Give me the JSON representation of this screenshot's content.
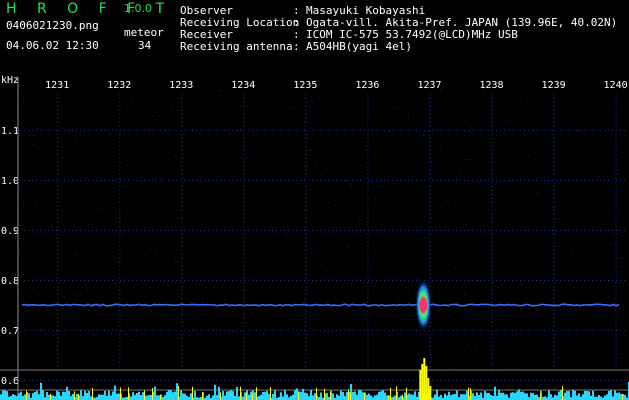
{
  "app": {
    "name": "H R O F F T",
    "version": "1.0.0"
  },
  "file": {
    "name": "0406021230.png",
    "datetime": "04.06.02 12:30",
    "meteor_label": "meteor",
    "meteor_count": "34"
  },
  "info": [
    {
      "label": "Observer",
      "sep": ":",
      "value": "Masayuki Kobayashi"
    },
    {
      "label": "Receiving Location",
      "sep": ":",
      "value": "Ogata-vill. Akita-Pref. JAPAN (139.96E, 40.02N)"
    },
    {
      "label": "Receiver",
      "sep": ":",
      "value": "ICOM IC-575 53.7492(@LCD)MHz USB"
    },
    {
      "label": "Receiving antenna",
      "sep": ":",
      "value": "A504HB(yagi 4el)"
    }
  ],
  "colors": {
    "background": "#000000",
    "title_green": "#27e05c",
    "noise_floor": "#3a6dff",
    "histogram": "#28d7ff",
    "meteor_peak": "#ffff00",
    "meteor_core": "#ff3070"
  },
  "chart_data": {
    "type": "heatmap",
    "ylabel": "kHz",
    "x_tick_labels": [
      "1231",
      "1232",
      "1233",
      "1234",
      "1235",
      "1236",
      "1237",
      "1238",
      "1239",
      "1240"
    ],
    "y_tick_labels": [
      "1.1",
      "1.0",
      "0.9",
      "0.8",
      "0.7",
      "0.6"
    ],
    "ylim": [
      0.6,
      1.2
    ],
    "xlim": [
      1230.4,
      1240.2
    ],
    "carrier_frequency": 0.75,
    "meteor_events": [
      {
        "time": 1236.9,
        "frequency": 0.75,
        "intensity": 1.0
      }
    ],
    "histogram_peak_time": 1236.9
  }
}
